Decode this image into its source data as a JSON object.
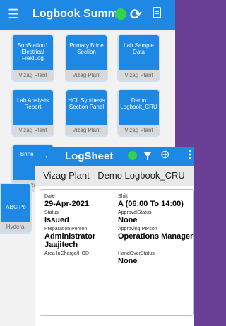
{
  "back_app": {
    "title": "Logbook Summ...",
    "tiles": [
      {
        "title": "SubStation1 Electrical FieldLog",
        "plant": "Vizag Plant"
      },
      {
        "title": "Primary Brine Section",
        "plant": "Vizag Plant"
      },
      {
        "title": "Lab Sample Data",
        "plant": "Vizag Plant"
      },
      {
        "title": "Lab Analysis Report",
        "plant": "Vizag Plant"
      },
      {
        "title": "HCL Synthesis Section Panel",
        "plant": "Vizag Plant"
      },
      {
        "title": "Demo Logbook_CRU",
        "plant": "Vizag Plant"
      },
      {
        "title": "Brine Pan",
        "plant": "Vizag"
      },
      {
        "title": "ABC Po",
        "plant": "Hyderal"
      }
    ]
  },
  "logsheet": {
    "title": "LogSheet",
    "subtitle": "Vizag Plant - Demo Logbook_CRU",
    "fields": {
      "date": {
        "label": "Date",
        "value": "29-Apr-2021"
      },
      "shift": {
        "label": "Shift",
        "value": "A (06:00 To 14:00)"
      },
      "status": {
        "label": "Status",
        "value": "Issued"
      },
      "approval_status": {
        "label": "ApprovalStatus",
        "value": "None"
      },
      "preparation_person": {
        "label": "Preparation Person",
        "value": "Administrator Jaajitech"
      },
      "approving_person": {
        "label": "Approving Person",
        "value": "Operations Manager"
      },
      "area_incharge": {
        "label": "Area InCharge/HOD",
        "value": ""
      },
      "handover_status": {
        "label": "HandOverStatus",
        "value": "None"
      }
    }
  },
  "colors": {
    "app_bar": "#1e88e5",
    "status_green": "#34d34a",
    "background_purple": "#6a3f96"
  },
  "icons": [
    "menu-icon",
    "sync-icon",
    "document-icon",
    "back-arrow-icon",
    "filter-icon",
    "add-circle-icon",
    "more-vert-icon"
  ]
}
